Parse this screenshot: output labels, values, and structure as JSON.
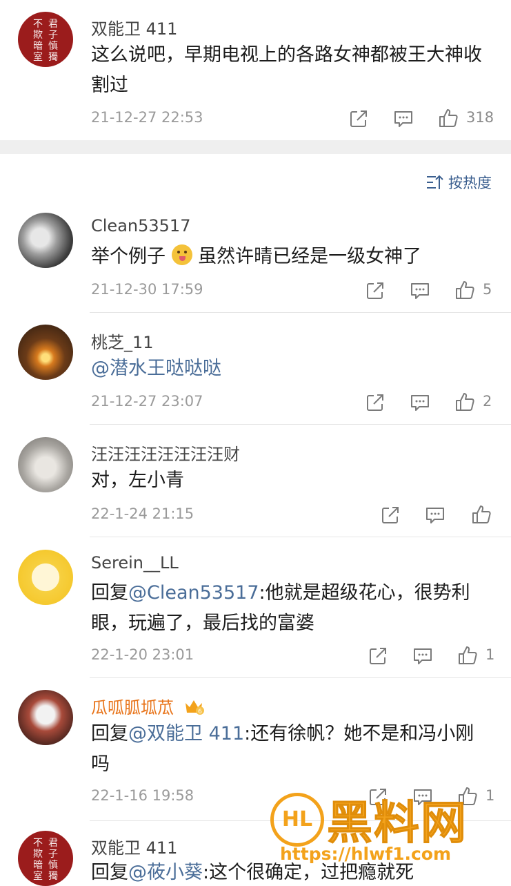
{
  "top_comment": {
    "username": "双能卫 411",
    "avatar_seal": [
      "君子慎獨",
      "不欺暗室"
    ],
    "content": "这么说吧，早期电视上的各路女神都被王大神收割过",
    "time": "21-12-27 22:53",
    "like_count": "318"
  },
  "sort_label": "按热度",
  "replies": [
    {
      "username": "Clean53517",
      "content_before": "举个例子",
      "content_after": "虽然许晴已经是一级女神了",
      "time": "21-12-30 17:59",
      "like_count": "5"
    },
    {
      "username": "桃芝_11",
      "mention": "@潜水王哒哒哒",
      "time": "21-12-27 23:07",
      "like_count": "2"
    },
    {
      "username": "汪汪汪汪汪汪汪汪财",
      "content": "对，左小青",
      "time": "22-1-24 21:15",
      "like_count": ""
    },
    {
      "username": "Serein__LL",
      "reply_prefix": "回复",
      "mention": "@Clean53517",
      "content": ":他就是超级花心，很势利眼，玩遍了，最后找的富婆",
      "time": "22-1-20 23:01",
      "like_count": "1"
    },
    {
      "username": "瓜呱胍坬苽",
      "reply_prefix": "回复",
      "mention": "@双能卫 411",
      "content": ":还有徐帆？她不是和冯小刚吗",
      "time": "22-1-16 19:58",
      "like_count": "1"
    },
    {
      "username": "双能卫 411",
      "reply_prefix": "回复",
      "mention": "@莜小葵",
      "content": ":这个很确定，过把瘾就死"
    }
  ],
  "watermark": {
    "logo_text": "HL",
    "title": "黑料网",
    "url": "https://hlwf1.com"
  },
  "colors": {
    "accent": "#4a6d98",
    "vip_name": "#e8741a",
    "watermark": "#f3a21b",
    "seal": "#9b1c1c"
  }
}
